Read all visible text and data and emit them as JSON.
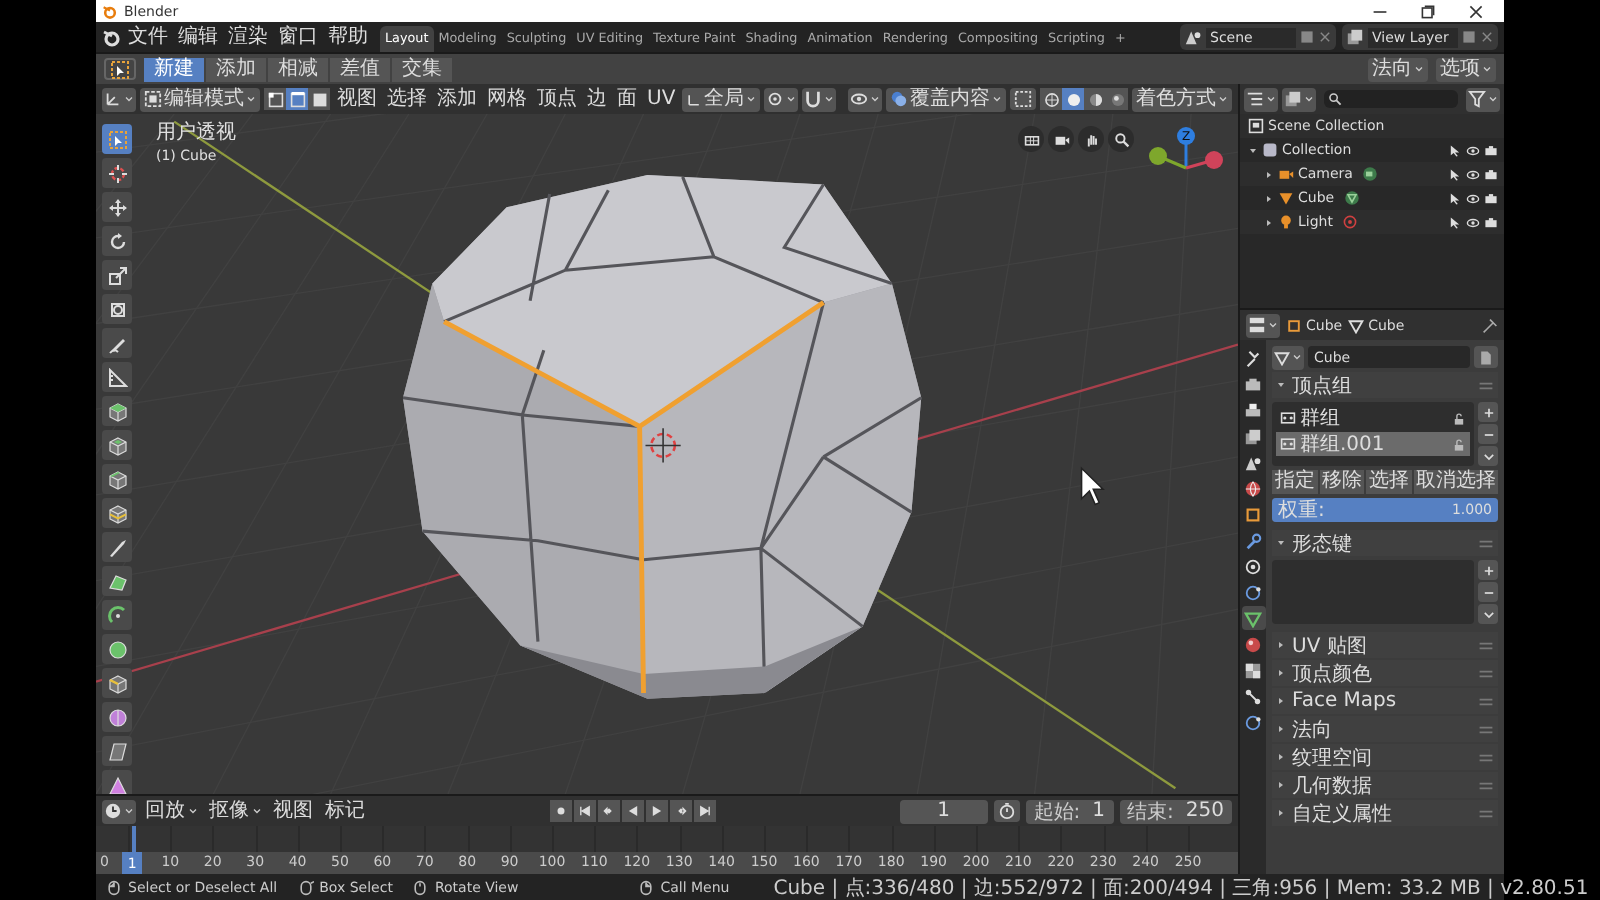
{
  "window": {
    "title": "Blender"
  },
  "menu": [
    "文件",
    "编辑",
    "渲染",
    "窗口",
    "帮助"
  ],
  "workspaces": [
    {
      "label": "Layout",
      "selected": true
    },
    {
      "label": "Modeling",
      "selected": false
    },
    {
      "label": "Sculpting",
      "selected": false
    },
    {
      "label": "UV Editing",
      "selected": false
    },
    {
      "label": "Texture Paint",
      "selected": false
    },
    {
      "label": "Shading",
      "selected": false
    },
    {
      "label": "Animation",
      "selected": false
    },
    {
      "label": "Rendering",
      "selected": false
    },
    {
      "label": "Compositing",
      "selected": false
    },
    {
      "label": "Scripting",
      "selected": false
    }
  ],
  "add_workspace": "+",
  "scene": {
    "value": "Scene"
  },
  "view_layer": {
    "value": "View Layer"
  },
  "tool_header": {
    "boolean_modes": [
      {
        "label": "新建",
        "selected": true
      },
      {
        "label": "添加",
        "selected": false
      },
      {
        "label": "相减",
        "selected": false
      },
      {
        "label": "差值",
        "selected": false
      },
      {
        "label": "交集",
        "selected": false
      }
    ],
    "dropdowns": [
      "法向",
      "选项"
    ]
  },
  "viewport_header": {
    "mode": "编辑模式",
    "select_modes": [
      {
        "kind": "vertex",
        "selected": false
      },
      {
        "kind": "edge",
        "selected": true
      },
      {
        "kind": "face",
        "selected": false
      }
    ],
    "menus": [
      "视图",
      "选择",
      "添加",
      "网格",
      "顶点",
      "边",
      "面",
      "UV"
    ],
    "orientation": "全局",
    "overlays": "覆盖内容",
    "shading_modes": [
      {
        "kind": "wireframe",
        "selected": false
      },
      {
        "kind": "solid",
        "selected": true
      },
      {
        "kind": "material",
        "selected": false
      },
      {
        "kind": "rendered",
        "selected": false
      }
    ],
    "shading": "着色方式"
  },
  "viewport": {
    "view_name": "用户透视",
    "object_label": "(1) Cube",
    "tools": [
      {
        "kind": "select",
        "selected": true
      },
      {
        "kind": "cursor",
        "selected": false
      },
      {
        "kind": "move",
        "selected": false
      },
      {
        "kind": "rotate",
        "selected": false
      },
      {
        "kind": "scale",
        "selected": false
      },
      {
        "kind": "transform",
        "selected": false
      },
      {
        "kind": "annotate",
        "selected": false
      },
      {
        "kind": "measure",
        "selected": false
      },
      {
        "kind": "extrude",
        "selected": false
      },
      {
        "kind": "inset",
        "selected": false
      },
      {
        "kind": "bevel",
        "selected": false
      },
      {
        "kind": "loopcut",
        "selected": false
      },
      {
        "kind": "knife",
        "selected": false
      },
      {
        "kind": "polybuild",
        "selected": false
      },
      {
        "kind": "spin",
        "selected": false
      },
      {
        "kind": "smooth",
        "selected": false
      },
      {
        "kind": "edgeslide",
        "selected": false
      },
      {
        "kind": "shrink",
        "selected": false
      },
      {
        "kind": "shear",
        "selected": false
      },
      {
        "kind": "rip",
        "selected": false
      }
    ],
    "gizmo": [
      {
        "label": "Z",
        "color": "#2e7ee0"
      },
      {
        "color": "#d0435a"
      },
      {
        "color": "#7ea72c"
      }
    ]
  },
  "outliner": {
    "root": "Scene Collection",
    "items": [
      {
        "label": "Collection",
        "kind": "collection",
        "expanded": true,
        "children": [
          {
            "label": "Camera",
            "kind": "camera",
            "expanded": false
          },
          {
            "label": "Cube",
            "kind": "mesh",
            "expanded": false
          },
          {
            "label": "Light",
            "kind": "light",
            "expanded": false
          }
        ]
      }
    ]
  },
  "properties": {
    "tabs": [
      {
        "kind": "tool",
        "selected": false
      },
      {
        "kind": "render",
        "selected": false
      },
      {
        "kind": "output",
        "selected": false
      },
      {
        "kind": "view_layer",
        "selected": false
      },
      {
        "kind": "scene",
        "selected": false
      },
      {
        "kind": "world",
        "selected": false
      },
      {
        "kind": "object",
        "selected": false
      },
      {
        "kind": "modifier",
        "selected": false
      },
      {
        "kind": "particles",
        "selected": false
      },
      {
        "kind": "physics",
        "selected": false
      },
      {
        "kind": "data",
        "selected": true
      },
      {
        "kind": "material",
        "selected": false
      },
      {
        "kind": "texture",
        "selected": false
      },
      {
        "kind": "constraint",
        "selected": false
      },
      {
        "kind": "physics",
        "selected": false
      }
    ],
    "object": "Cube",
    "mesh": "Cube",
    "data_name": "Cube",
    "panels": [
      {
        "kind": "vertex_groups",
        "title": "顶点组",
        "expanded": true,
        "items": [
          {
            "label": "群组",
            "selected": false
          },
          {
            "label": "群组.001",
            "selected": true
          }
        ],
        "buttons": [
          "指定",
          "移除",
          "选择",
          "取消选择"
        ],
        "weight": {
          "label": "权重:",
          "value": "1.000",
          "level": 1
        }
      },
      {
        "kind": "shape_keys",
        "title": "形态键",
        "expanded": true
      },
      {
        "title": "UV 贴图",
        "expanded": false
      },
      {
        "title": "顶点颜色",
        "expanded": false
      },
      {
        "title": "Face Maps",
        "expanded": false
      },
      {
        "title": "法向",
        "expanded": false
      },
      {
        "title": "纹理空间",
        "expanded": false
      },
      {
        "title": "几何数据",
        "expanded": false
      },
      {
        "title": "自定义属性",
        "expanded": false
      }
    ]
  },
  "timeline": {
    "menus": [
      {
        "label": "回放",
        "dropdown": true
      },
      {
        "label": "抠像",
        "dropdown": true
      },
      {
        "label": "视图",
        "dropdown": false
      },
      {
        "label": "标记",
        "dropdown": false
      }
    ],
    "current_frame": "1",
    "start": {
      "label": "起始:",
      "value": "1"
    },
    "end": {
      "label": "结束:",
      "value": "250"
    },
    "ruler": [
      "0",
      "10",
      "20",
      "30",
      "40",
      "50",
      "60",
      "70",
      "80",
      "90",
      "100",
      "110",
      "120",
      "130",
      "140",
      "150",
      "160",
      "170",
      "180",
      "190",
      "200",
      "210",
      "220",
      "230",
      "240",
      "250"
    ],
    "playhead": "1"
  },
  "status_bar": {
    "hints": [
      {
        "kind": "mouse_left",
        "label": "Select or Deselect All"
      },
      {
        "kind": "mouse_drag",
        "label": "Box Select"
      },
      {
        "kind": "mouse_middle",
        "label": "Rotate View"
      },
      {
        "kind": "mouse_right",
        "label": "Call Menu"
      }
    ],
    "stats": "Cube | 点:336/480 | 边:552/972 | 面:200/494 | 三角:956 | Mem: 33.2 MB | v2.80.51"
  }
}
